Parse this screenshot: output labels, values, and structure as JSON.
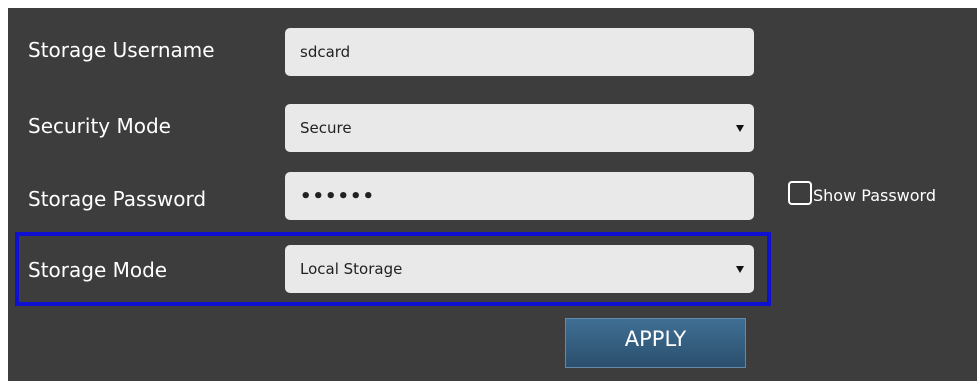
{
  "form": {
    "storage_username": {
      "label": "Storage Username",
      "value": "sdcard"
    },
    "security_mode": {
      "label": "Security Mode",
      "value": "Secure",
      "icon": "chevron-down-icon"
    },
    "storage_password": {
      "label": "Storage Password",
      "value": "••••••"
    },
    "show_password": {
      "label": "Show Password",
      "checked": false
    },
    "storage_mode": {
      "label": "Storage Mode",
      "value": "Local Storage",
      "icon": "chevron-down-icon"
    },
    "apply_label": "APPLY"
  },
  "colors": {
    "panel_background": "#3d3d3d",
    "field_background": "#e9e9e9",
    "highlight_border": "#1010d0",
    "apply_button": "#3f6f94"
  }
}
